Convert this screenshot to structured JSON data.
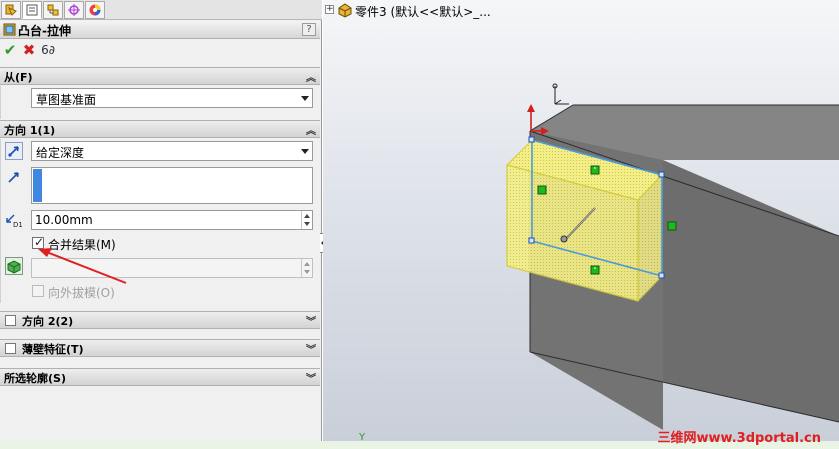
{
  "tabs": [
    {
      "icon": "feature-manager-icon"
    },
    {
      "icon": "property-manager-icon"
    },
    {
      "icon": "configuration-manager-icon"
    },
    {
      "icon": "dimxpert-icon"
    },
    {
      "icon": "display-manager-icon"
    }
  ],
  "property_manager": {
    "title": "凸台-拉伸",
    "help": "?",
    "actions": {
      "ok": "✔",
      "cancel": "✖",
      "preview": "6∂"
    }
  },
  "from": {
    "header": "从(F)",
    "value": "草图基准面"
  },
  "direction1": {
    "header": "方向 1(1)",
    "end_condition": "给定深度",
    "depth": "10.00mm",
    "merge_result": "合并结果(M)",
    "merge_checked": true,
    "draft_outward": "向外拔模(O)"
  },
  "direction2": {
    "header": "方向 2(2)"
  },
  "thin_feature": {
    "header": "薄壁特征(T)"
  },
  "selected_contours": {
    "header": "所选轮廓(S)"
  },
  "viewport": {
    "tree_label": "零件3  (默认<<默认>_...",
    "axis_y": "Y"
  },
  "watermark": "三维网www.3dportal.cn",
  "colors": {
    "preview_fill": "#f3ee8a",
    "preview_edge": "#4c9bd8",
    "preview_outline": "#d4cc3a",
    "body_gray": "#6f6f6f",
    "annotation_red": "#e02020"
  }
}
